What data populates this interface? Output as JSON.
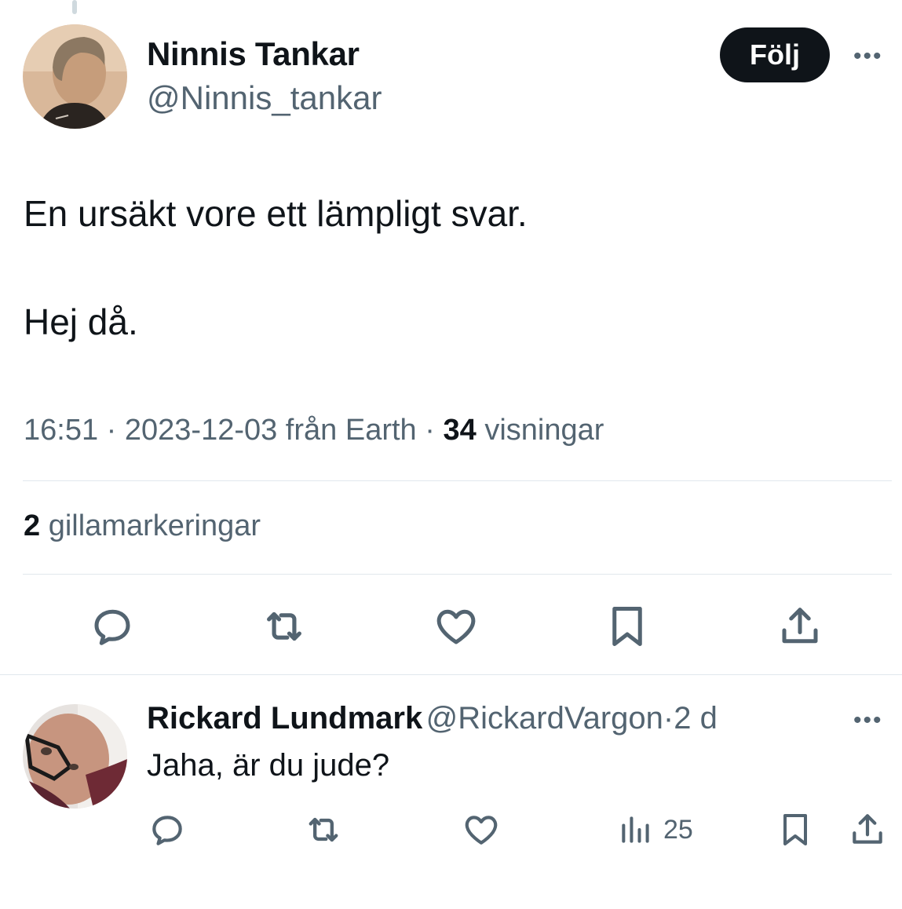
{
  "tweet": {
    "author_name": "Ninnis Tankar",
    "author_handle": "@Ninnis_tankar",
    "follow_label": "Följ",
    "more_label": "•••",
    "text_line1": "En ursäkt vore ett lämpligt svar.",
    "text_line2": "Hej då.",
    "time": "16:51",
    "sep1": "·",
    "date": "2023-12-03 från Earth",
    "sep2": "·",
    "views_count": "34",
    "views_label": "visningar",
    "likes_count": "2",
    "likes_label": "gillamarkeringar",
    "actions": [
      "reply-icon",
      "retweet-icon",
      "heart-icon",
      "bookmark-icon",
      "share-icon"
    ]
  },
  "reply": {
    "author_name": "Rickard Lundmark",
    "author_handle": "@RickardVargon",
    "sep": "·",
    "age": "2 d",
    "more_label": "•••",
    "text": "Jaha, är du jude?",
    "views_count": "25",
    "actions": [
      "reply-icon",
      "retweet-icon",
      "heart-icon",
      "analytics-icon",
      "bookmark-icon",
      "share-icon"
    ]
  },
  "colors": {
    "text": "#0f1419",
    "secondary": "#536471",
    "divider": "#e1e8ed",
    "follow_bg": "#0f1419"
  }
}
